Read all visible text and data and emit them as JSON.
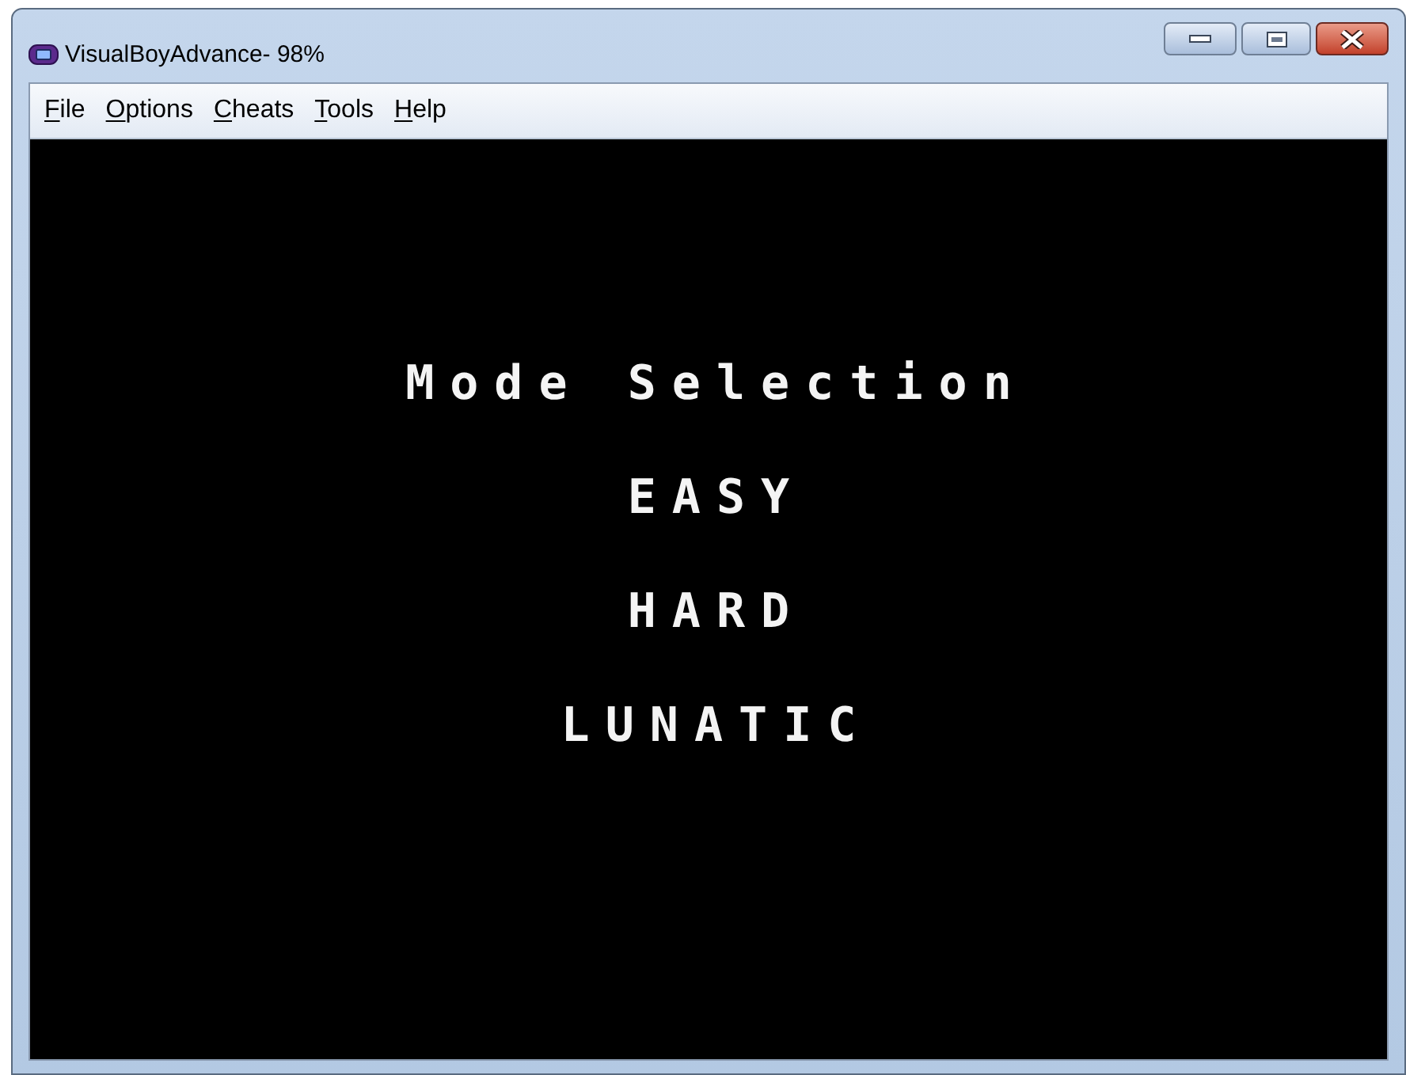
{
  "window": {
    "title": "VisualBoyAdvance- 98%"
  },
  "menu": [
    {
      "label": "File"
    },
    {
      "label": "Options"
    },
    {
      "label": "Cheats"
    },
    {
      "label": "Tools"
    },
    {
      "label": "Help"
    }
  ],
  "game_screen": {
    "heading": "Mode Selection",
    "options": [
      "EASY",
      "HARD",
      "LUNATIC"
    ]
  }
}
